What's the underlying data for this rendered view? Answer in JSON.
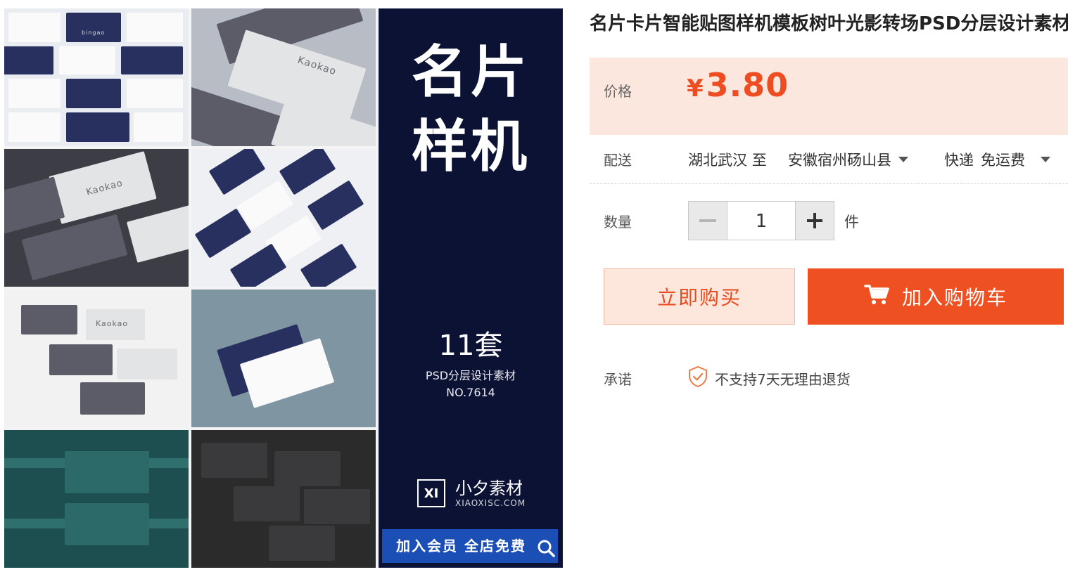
{
  "product": {
    "title": "名片卡片智能贴图样机模板树叶光影转场PSD分层设计素材",
    "image": {
      "tile_texts": {
        "kaokao": "Kaokao",
        "bingao": "bingao"
      },
      "side_panel": {
        "line1": "名片",
        "line2": "样机",
        "count": "11套",
        "desc": "PSD分层设计素材",
        "code": "NO.7614",
        "brand_mark": "XI",
        "brand_name": "小夕素材",
        "brand_url": "XIAOXISC.COM",
        "banner": "加入会员 全店免费"
      }
    }
  },
  "price": {
    "label": "价格",
    "currency": "¥",
    "amount": "3.80"
  },
  "shipping": {
    "label": "配送",
    "from": "湖北武汉",
    "to_word": "至",
    "destination": "安徽宿州砀山县",
    "method": "快递",
    "fee": "免运费"
  },
  "quantity": {
    "label": "数量",
    "value": "1",
    "unit": "件",
    "minus": "−",
    "plus": "+"
  },
  "actions": {
    "buy_now": "立即购买",
    "add_to_cart": "加入购物车"
  },
  "promise": {
    "label": "承诺",
    "text": "不支持7天无理由退货"
  },
  "colors": {
    "accent": "#ee5022",
    "price": "#ee4d22",
    "price_bg": "#fbe7de"
  },
  "icons": [
    "cart-icon",
    "shield-check-icon",
    "zoom-icon",
    "caret-down-icon"
  ]
}
